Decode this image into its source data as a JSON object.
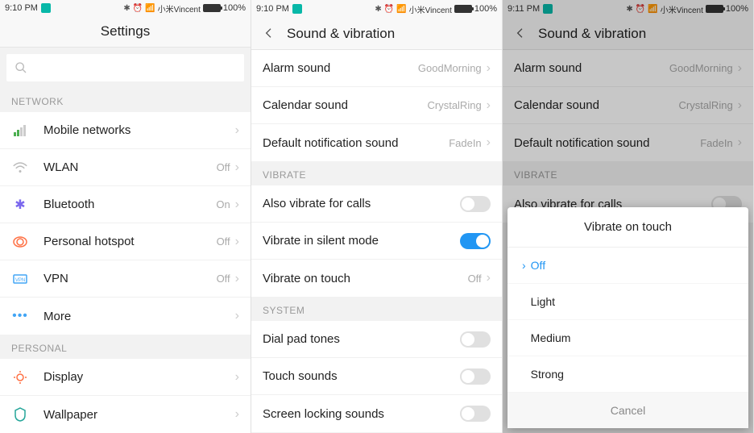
{
  "screen1": {
    "status": {
      "time": "9:10 PM",
      "carrier": "小米Vincent",
      "battery": "100%"
    },
    "title": "Settings",
    "sections": {
      "network": {
        "header": "NETWORK",
        "items": {
          "mobile": {
            "label": "Mobile networks",
            "value": ""
          },
          "wlan": {
            "label": "WLAN",
            "value": "Off"
          },
          "bluetooth": {
            "label": "Bluetooth",
            "value": "On"
          },
          "hotspot": {
            "label": "Personal hotspot",
            "value": "Off"
          },
          "vpn": {
            "label": "VPN",
            "value": "Off"
          },
          "more": {
            "label": "More",
            "value": ""
          }
        }
      },
      "personal": {
        "header": "PERSONAL",
        "items": {
          "display": {
            "label": "Display",
            "value": ""
          },
          "wallpaper": {
            "label": "Wallpaper",
            "value": ""
          }
        }
      }
    }
  },
  "screen2": {
    "status": {
      "time": "9:10 PM",
      "carrier": "小米Vincent",
      "battery": "100%"
    },
    "title": "Sound & vibration",
    "sounds": {
      "alarm": {
        "label": "Alarm sound",
        "value": "GoodMorning"
      },
      "calendar": {
        "label": "Calendar sound",
        "value": "CrystalRing"
      },
      "notification": {
        "label": "Default notification sound",
        "value": "FadeIn"
      }
    },
    "vibrate_header": "VIBRATE",
    "vibrate": {
      "calls": {
        "label": "Also vibrate for calls",
        "on": false
      },
      "silent": {
        "label": "Vibrate in silent mode",
        "on": true
      },
      "touch": {
        "label": "Vibrate on touch",
        "value": "Off"
      }
    },
    "system_header": "SYSTEM",
    "system": {
      "dialpad": {
        "label": "Dial pad tones",
        "on": false
      },
      "touchsounds": {
        "label": "Touch sounds",
        "on": false
      },
      "locking": {
        "label": "Screen locking sounds",
        "on": false
      }
    }
  },
  "screen3": {
    "status": {
      "time": "9:11 PM",
      "carrier": "小米Vincent",
      "battery": "100%"
    },
    "title": "Sound & vibration",
    "sounds": {
      "alarm": {
        "label": "Alarm sound",
        "value": "GoodMorning"
      },
      "calendar": {
        "label": "Calendar sound",
        "value": "CrystalRing"
      },
      "notification": {
        "label": "Default notification sound",
        "value": "FadeIn"
      }
    },
    "vibrate_header": "VIBRATE",
    "vibrate": {
      "calls": {
        "label": "Also vibrate for calls",
        "on": false
      }
    },
    "dialog": {
      "title": "Vibrate on touch",
      "options": {
        "off": "Off",
        "light": "Light",
        "medium": "Medium",
        "strong": "Strong"
      },
      "cancel": "Cancel"
    }
  }
}
